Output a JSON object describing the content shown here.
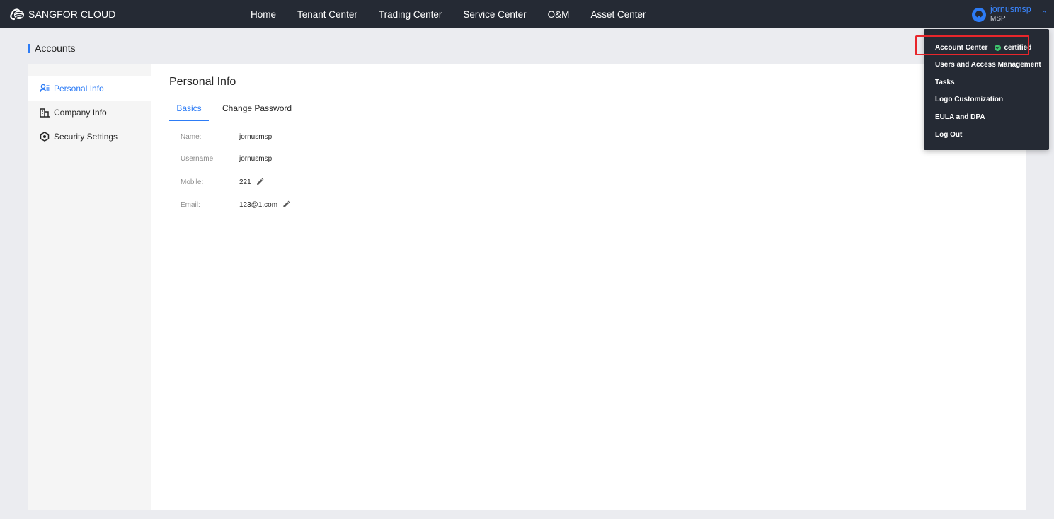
{
  "header": {
    "brand": "SANGFOR CLOUD",
    "nav": [
      "Home",
      "Tenant Center",
      "Trading Center",
      "Service Center",
      "O&M",
      "Asset Center"
    ],
    "user": {
      "name": "jornusmsp",
      "role": "MSP",
      "caret_icon": "chevron-up-icon"
    }
  },
  "user_menu": {
    "items": [
      {
        "label": "Account Center",
        "badge": "certified",
        "badge_icon": "check-circle-icon",
        "highlighted": true
      },
      {
        "label": "Users and Access Management"
      },
      {
        "label": "Tasks"
      },
      {
        "label": "Logo Customization"
      },
      {
        "label": "EULA and DPA"
      },
      {
        "label": "Log Out"
      }
    ],
    "highlight_color": "#e8262b"
  },
  "page": {
    "title": "Accounts"
  },
  "sidebar": {
    "items": [
      {
        "label": "Personal Info",
        "icon": "user-list-icon",
        "active": true
      },
      {
        "label": "Company Info",
        "icon": "building-icon",
        "active": false
      },
      {
        "label": "Security Settings",
        "icon": "shield-icon",
        "active": false
      }
    ]
  },
  "main": {
    "title": "Personal Info",
    "tabs": [
      {
        "label": "Basics",
        "active": true
      },
      {
        "label": "Change Password",
        "active": false
      }
    ],
    "fields": [
      {
        "label": "Name:",
        "value": "jornusmsp",
        "editable": false
      },
      {
        "label": "Username:",
        "value": "jornusmsp",
        "editable": false
      },
      {
        "label": "Mobile:",
        "value": "221",
        "editable": true
      },
      {
        "label": "Email:",
        "value": "123@1.com",
        "editable": true
      }
    ]
  },
  "colors": {
    "accent": "#2d7cf6",
    "topbar": "#252a34",
    "background": "#ebecf0",
    "certified": "#3ec46d"
  }
}
